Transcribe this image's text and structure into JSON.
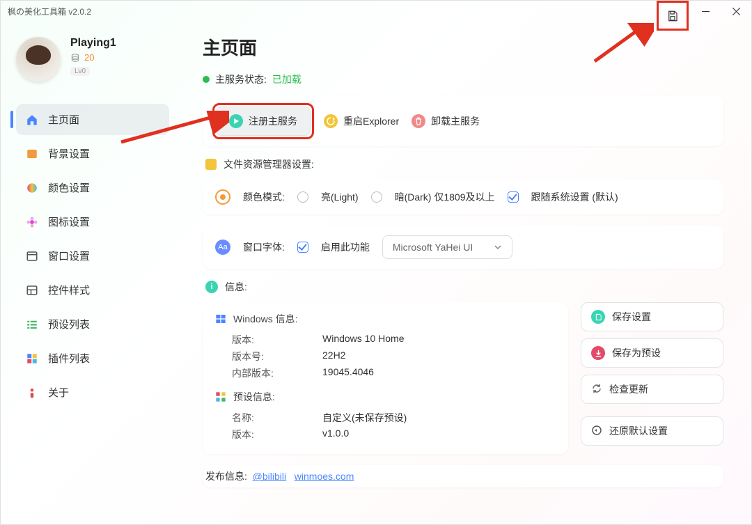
{
  "window": {
    "title": "枫の美化工具箱 v2.0.2"
  },
  "user": {
    "name": "Playing1",
    "coins": "20",
    "level": "Lv0"
  },
  "nav": {
    "home": "主页面",
    "background": "背景设置",
    "color": "颜色设置",
    "icon": "图标设置",
    "window": "窗口设置",
    "control": "控件样式",
    "preset": "预设列表",
    "plugin": "插件列表",
    "about": "关于"
  },
  "page": {
    "title": "主页面",
    "status_label": "主服务状态:",
    "status_value": "已加载",
    "btn_register": "注册主服务",
    "btn_restart": "重启Explorer",
    "btn_uninstall": "卸载主服务",
    "explorer_section": "文件资源管理器设置:",
    "color_mode_label": "颜色模式:",
    "light": "亮(Light)",
    "dark": "暗(Dark) 仅1809及以上",
    "follow_system": "跟随系统设置 (默认)",
    "font_label": "窗口字体:",
    "font_enable": "启用此功能",
    "font_value": "Microsoft YaHei UI",
    "info_section": "信息:",
    "win_info": "Windows 信息:",
    "win_version_k": "版本:",
    "win_version_v": "Windows 10 Home",
    "win_build_k": "版本号:",
    "win_build_v": "22H2",
    "win_internal_k": "内部版本:",
    "win_internal_v": "19045.4046",
    "preset_info": "预设信息:",
    "preset_name_k": "名称:",
    "preset_name_v": "自定义(未保存预设)",
    "preset_ver_k": "版本:",
    "preset_ver_v": "v1.0.0",
    "save_settings": "保存设置",
    "save_preset": "保存为预设",
    "check_update": "检查更新",
    "restore_default": "还原默认设置",
    "publish_label": "发布信息:",
    "link1": "@bilibili",
    "link2": "winmoes.com"
  }
}
